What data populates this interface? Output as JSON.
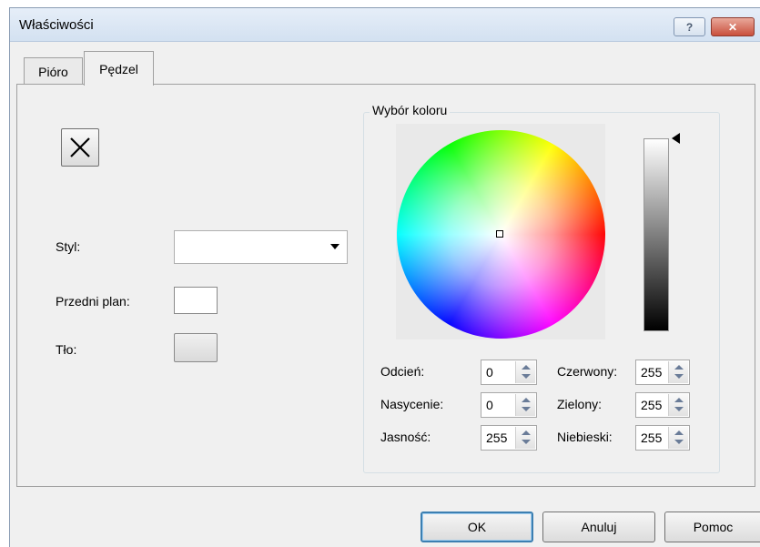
{
  "window": {
    "title": "Właściwości",
    "help_button": "?",
    "close_button": "✕"
  },
  "tabs": [
    {
      "label": "Pióro",
      "active": false
    },
    {
      "label": "Pędzel",
      "active": true
    }
  ],
  "brush": {
    "styl_label": "Styl:",
    "styl_value": "",
    "foreground_label": "Przedni plan:",
    "background_label": "Tło:"
  },
  "color_picker": {
    "group_title": "Wybór koloru",
    "fields": {
      "hue": {
        "label": "Odcień:",
        "value": "0"
      },
      "saturation": {
        "label": "Nasycenie:",
        "value": "0"
      },
      "brightness": {
        "label": "Jasność:",
        "value": "255"
      },
      "red": {
        "label": "Czerwony:",
        "value": "255"
      },
      "green": {
        "label": "Zielony:",
        "value": "255"
      },
      "blue": {
        "label": "Niebieski:",
        "value": "255"
      }
    }
  },
  "buttons": {
    "ok": "OK",
    "cancel": "Anuluj",
    "help": "Pomoc"
  },
  "colors": {
    "foreground_swatch": "#ffffff",
    "background_swatch": "#e6e6e6",
    "close_accent": "#c9503d"
  }
}
